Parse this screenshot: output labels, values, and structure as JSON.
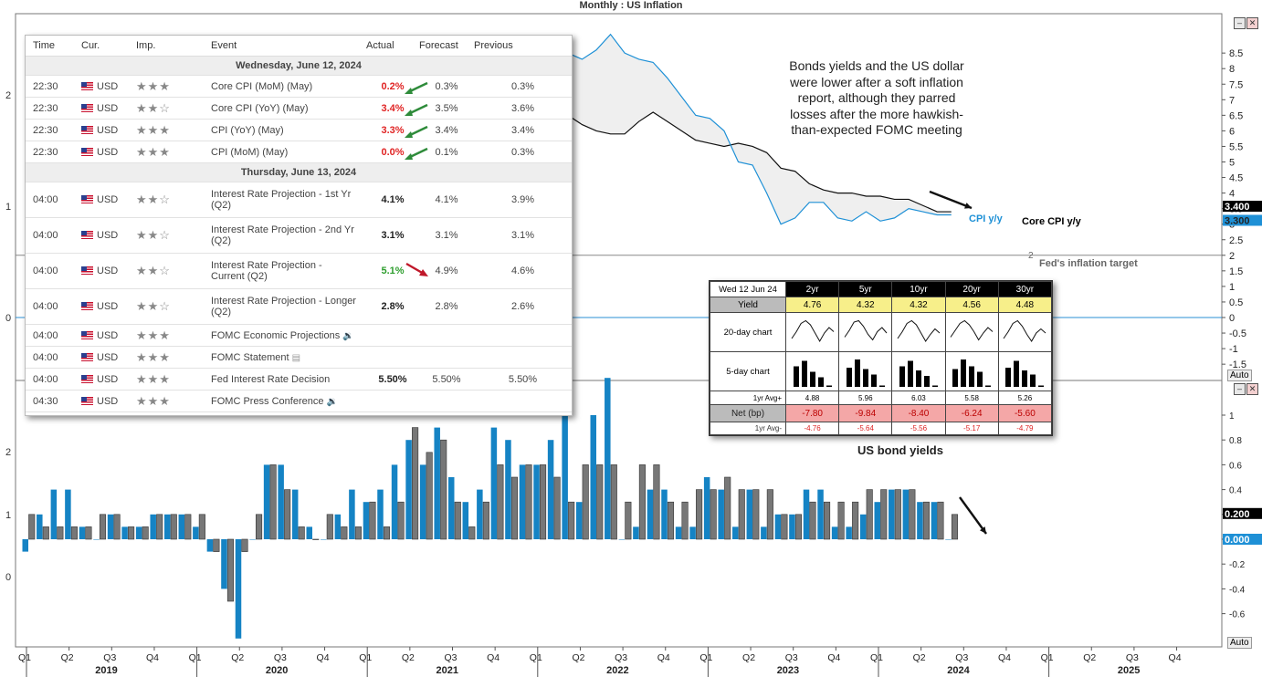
{
  "window_title": "Monthly : US Inflation",
  "controls": {
    "minimize": "–",
    "close": "✕",
    "auto_label": "Auto"
  },
  "annotation_text": "Bonds yields and the US dollar were lower after a soft inflation report, although they parred losses after the more hawkish-than-expected FOMC meeting",
  "fed_target_label": "Fed's inflation target",
  "fed_target_level": "2",
  "colors": {
    "cpi": "#1e90d6",
    "core": "#111111",
    "bar_blue": "#1583c4",
    "bar_gray": "#777777",
    "green_arrow": "#2e8b3a",
    "red_arrow": "#c0182a"
  },
  "calendar": {
    "headers": {
      "time": "Time",
      "currency": "Cur.",
      "importance": "Imp.",
      "event": "Event",
      "actual": "Actual",
      "forecast": "Forecast",
      "previous": "Previous"
    },
    "days": [
      {
        "label": "Wednesday, June 12, 2024",
        "events": [
          {
            "time": "22:30",
            "cur": "USD",
            "stars": "★★★",
            "event": "Core CPI (MoM) (May)",
            "event2": "",
            "actual": "0.2%",
            "actual_color": "red",
            "forecast": "0.3%",
            "previous": "0.3%",
            "arrow": "green"
          },
          {
            "time": "22:30",
            "cur": "USD",
            "stars": "★★☆",
            "event": "Core CPI (YoY) (May)",
            "event2": "",
            "actual": "3.4%",
            "actual_color": "red",
            "forecast": "3.5%",
            "previous": "3.6%",
            "arrow": "green"
          },
          {
            "time": "22:30",
            "cur": "USD",
            "stars": "★★★",
            "event": "CPI (YoY) (May)",
            "event2": "",
            "actual": "3.3%",
            "actual_color": "red",
            "forecast": "3.4%",
            "previous": "3.4%",
            "arrow": "green"
          },
          {
            "time": "22:30",
            "cur": "USD",
            "stars": "★★★",
            "event": "CPI (MoM) (May)",
            "event2": "",
            "actual": "0.0%",
            "actual_color": "red",
            "forecast": "0.1%",
            "previous": "0.3%",
            "arrow": "green"
          }
        ]
      },
      {
        "label": "Thursday, June 13, 2024",
        "events": [
          {
            "time": "04:00",
            "cur": "USD",
            "stars": "★★☆",
            "event": "Interest Rate Projection - 1st Yr",
            "event2": "(Q2)",
            "actual": "4.1%",
            "actual_color": "black",
            "forecast": "4.1%",
            "previous": "3.9%",
            "arrow": ""
          },
          {
            "time": "04:00",
            "cur": "USD",
            "stars": "★★☆",
            "event": "Interest Rate Projection - 2nd Yr",
            "event2": "(Q2)",
            "actual": "3.1%",
            "actual_color": "black",
            "forecast": "3.1%",
            "previous": "3.1%",
            "arrow": ""
          },
          {
            "time": "04:00",
            "cur": "USD",
            "stars": "★★☆",
            "event": "Interest Rate Projection -",
            "event2": "Current (Q2)",
            "actual": "5.1%",
            "actual_color": "green",
            "forecast": "4.9%",
            "previous": "4.6%",
            "arrow": "red"
          },
          {
            "time": "04:00",
            "cur": "USD",
            "stars": "★★☆",
            "event": "Interest Rate Projection - Longer",
            "event2": "(Q2)",
            "actual": "2.8%",
            "actual_color": "black",
            "forecast": "2.8%",
            "previous": "2.6%",
            "arrow": ""
          },
          {
            "time": "04:00",
            "cur": "USD",
            "stars": "★★★",
            "event": "FOMC Economic Projections",
            "event2": "",
            "actual": "",
            "actual_color": "black",
            "forecast": "",
            "previous": "",
            "arrow": "",
            "icon": "speaker-icon"
          },
          {
            "time": "04:00",
            "cur": "USD",
            "stars": "★★★",
            "event": "FOMC Statement",
            "event2": "",
            "actual": "",
            "actual_color": "black",
            "forecast": "",
            "previous": "",
            "arrow": "",
            "icon": "document-icon"
          },
          {
            "time": "04:00",
            "cur": "USD",
            "stars": "★★★",
            "event": "Fed Interest Rate Decision",
            "event2": "",
            "actual": "5.50%",
            "actual_color": "black",
            "forecast": "5.50%",
            "previous": "5.50%",
            "arrow": ""
          },
          {
            "time": "04:30",
            "cur": "USD",
            "stars": "★★★",
            "event": "FOMC Press Conference",
            "event2": "",
            "actual": "",
            "actual_color": "black",
            "forecast": "",
            "previous": "",
            "arrow": "",
            "icon": "speaker-icon"
          }
        ]
      }
    ]
  },
  "bond_table": {
    "date": "Wed 12 Jun 24",
    "tenors": [
      "2yr",
      "5yr",
      "10yr",
      "20yr",
      "30yr"
    ],
    "yield_label": "Yield",
    "yields": [
      "4.76",
      "4.32",
      "4.32",
      "4.56",
      "4.48"
    ],
    "chart20_label": "20-day chart",
    "chart5_label": "5-day chart",
    "avg_plus_label": "1yr Avg+",
    "avg_plus": [
      "4.88",
      "5.96",
      "6.03",
      "5.58",
      "5.26"
    ],
    "net_label": "Net (bp)",
    "net": [
      "-7.80",
      "-9.84",
      "-8.40",
      "-6.24",
      "-5.60"
    ],
    "avg_minus_label": "1yr Avg-",
    "avg_minus": [
      "-4.76",
      "-5.64",
      "-5.56",
      "-5.17",
      "-4.79"
    ],
    "caption": "US bond yields",
    "spark20": [
      [
        0.3,
        0.55,
        0.85,
        0.95,
        0.8,
        0.5,
        0.2,
        0.5,
        0.7,
        0.55
      ],
      [
        0.35,
        0.6,
        0.9,
        0.95,
        0.75,
        0.45,
        0.25,
        0.55,
        0.7,
        0.5
      ],
      [
        0.3,
        0.55,
        0.85,
        0.95,
        0.8,
        0.5,
        0.2,
        0.45,
        0.65,
        0.5
      ],
      [
        0.35,
        0.6,
        0.85,
        0.95,
        0.8,
        0.55,
        0.25,
        0.5,
        0.7,
        0.55
      ],
      [
        0.3,
        0.55,
        0.85,
        0.95,
        0.75,
        0.45,
        0.2,
        0.5,
        0.65,
        0.5
      ]
    ],
    "spark5": [
      [
        0.75,
        0.95,
        0.55,
        0.35,
        0.05
      ],
      [
        0.7,
        1.0,
        0.65,
        0.45,
        0.05
      ],
      [
        0.75,
        0.95,
        0.6,
        0.4,
        0.05
      ],
      [
        0.65,
        1.0,
        0.75,
        0.55,
        0.05
      ],
      [
        0.7,
        0.95,
        0.6,
        0.45,
        0.05
      ]
    ]
  },
  "chart_data": [
    {
      "type": "line",
      "title": "Monthly : US Inflation",
      "series": [
        {
          "name": "CPI y/y",
          "values": [
            1.5,
            1.6,
            1.9,
            2.0,
            1.8,
            1.6,
            1.8,
            1.7,
            1.7,
            1.8,
            2.1,
            2.3,
            2.5,
            2.3,
            1.5,
            0.3,
            0.1,
            0.6,
            1.0,
            1.3,
            1.4,
            1.2,
            1.2,
            1.4,
            1.4,
            1.7,
            2.6,
            4.2,
            5.0,
            5.4,
            5.4,
            5.3,
            5.4,
            6.2,
            6.8,
            7.0,
            7.5,
            7.9,
            8.5,
            8.3,
            8.6,
            9.1,
            8.5,
            8.3,
            8.2,
            7.7,
            7.1,
            6.5,
            6.4,
            6.0,
            5.0,
            4.9,
            4.0,
            3.0,
            3.2,
            3.7,
            3.7,
            3.2,
            3.1,
            3.4,
            3.1,
            3.2,
            3.5,
            3.4,
            3.3,
            3.3
          ]
        },
        {
          "name": "Core CPI y/y",
          "values": [
            2.2,
            2.1,
            2.0,
            2.1,
            2.0,
            2.1,
            2.2,
            2.4,
            2.4,
            2.3,
            2.3,
            2.3,
            2.3,
            2.4,
            2.1,
            1.4,
            1.2,
            1.2,
            1.6,
            1.7,
            1.7,
            1.6,
            1.6,
            1.6,
            1.4,
            1.3,
            1.6,
            3.0,
            3.8,
            4.5,
            4.3,
            4.0,
            4.0,
            4.6,
            4.9,
            5.5,
            6.0,
            6.4,
            6.5,
            6.2,
            6.0,
            5.9,
            5.9,
            6.3,
            6.6,
            6.3,
            6.0,
            5.7,
            5.6,
            5.5,
            5.6,
            5.5,
            5.3,
            4.8,
            4.7,
            4.3,
            4.1,
            4.0,
            4.0,
            3.9,
            3.9,
            3.8,
            3.8,
            3.6,
            3.4,
            3.4
          ]
        }
      ],
      "x_start": "2019-01",
      "right_axis": [
        "-1.5",
        "-1",
        "-0.5",
        "0",
        "0.5",
        "1",
        "1.5",
        "2",
        "2.5",
        "3",
        "3.5",
        "4",
        "4.5",
        "5",
        "5.5",
        "6",
        "6.5",
        "7",
        "7.5",
        "8",
        "8.5"
      ],
      "left_axis": [
        "0",
        "1",
        "2"
      ],
      "last_values": [
        "3.400",
        "3.300"
      ],
      "fed_target": 2
    },
    {
      "type": "bar",
      "series": [
        {
          "name": "CPI m/m",
          "values": [
            -0.1,
            0.2,
            0.4,
            0.4,
            0.1,
            0.0,
            0.2,
            0.1,
            0.1,
            0.2,
            0.2,
            0.2,
            0.1,
            -0.1,
            -0.4,
            -0.8,
            0.0,
            0.6,
            0.6,
            0.4,
            0.1,
            0.0,
            0.2,
            0.4,
            0.3,
            0.4,
            0.6,
            0.8,
            0.6,
            0.9,
            0.5,
            0.3,
            0.4,
            0.9,
            0.8,
            0.6,
            0.6,
            0.8,
            1.2,
            0.3,
            1.0,
            1.3,
            0.0,
            0.1,
            0.4,
            0.4,
            0.1,
            0.1,
            0.5,
            0.4,
            0.1,
            0.4,
            0.1,
            0.2,
            0.2,
            0.4,
            0.4,
            0.1,
            0.1,
            0.2,
            0.3,
            0.4,
            0.4,
            0.3,
            0.3,
            0.0
          ]
        },
        {
          "name": "Core CPI m/m",
          "values": [
            0.2,
            0.1,
            0.1,
            0.1,
            0.1,
            0.2,
            0.2,
            0.1,
            0.1,
            0.2,
            0.2,
            0.2,
            0.2,
            -0.1,
            -0.5,
            -0.1,
            0.2,
            0.6,
            0.4,
            0.1,
            0.0,
            0.2,
            0.1,
            0.1,
            0.3,
            0.1,
            0.3,
            0.9,
            0.7,
            0.8,
            0.3,
            0.1,
            0.3,
            0.6,
            0.5,
            0.6,
            0.6,
            0.5,
            0.3,
            0.6,
            0.6,
            0.6,
            0.3,
            0.6,
            0.6,
            0.3,
            0.3,
            0.4,
            0.4,
            0.5,
            0.4,
            0.4,
            0.4,
            0.2,
            0.2,
            0.3,
            0.3,
            0.3,
            0.3,
            0.4,
            0.4,
            0.4,
            0.4,
            0.3,
            0.3,
            0.2
          ]
        }
      ],
      "right_axis": [
        "-0.6",
        "-0.4",
        "-0.2",
        "0",
        "0.2",
        "0.4",
        "0.6",
        "0.8",
        "1"
      ],
      "left_axis": [
        "0",
        "1",
        "2"
      ],
      "last_values": [
        "0.200",
        "0.000"
      ]
    }
  ],
  "x_axis": {
    "quarters": [
      "Q1",
      "Q2",
      "Q3",
      "Q4",
      "Q1",
      "Q2",
      "Q3",
      "Q4",
      "Q1",
      "Q2",
      "Q3",
      "Q4",
      "Q1",
      "Q2",
      "Q3",
      "Q4",
      "Q1",
      "Q2",
      "Q3",
      "Q4",
      "Q1",
      "Q2",
      "Q3",
      "Q4",
      "Q1",
      "Q2",
      "Q3",
      "Q4"
    ],
    "years": [
      "2019",
      "2020",
      "2021",
      "2022",
      "2023",
      "2024",
      "2025"
    ]
  },
  "labels": {
    "cpi": "CPI y/y",
    "core": "Core CPI y/y"
  }
}
